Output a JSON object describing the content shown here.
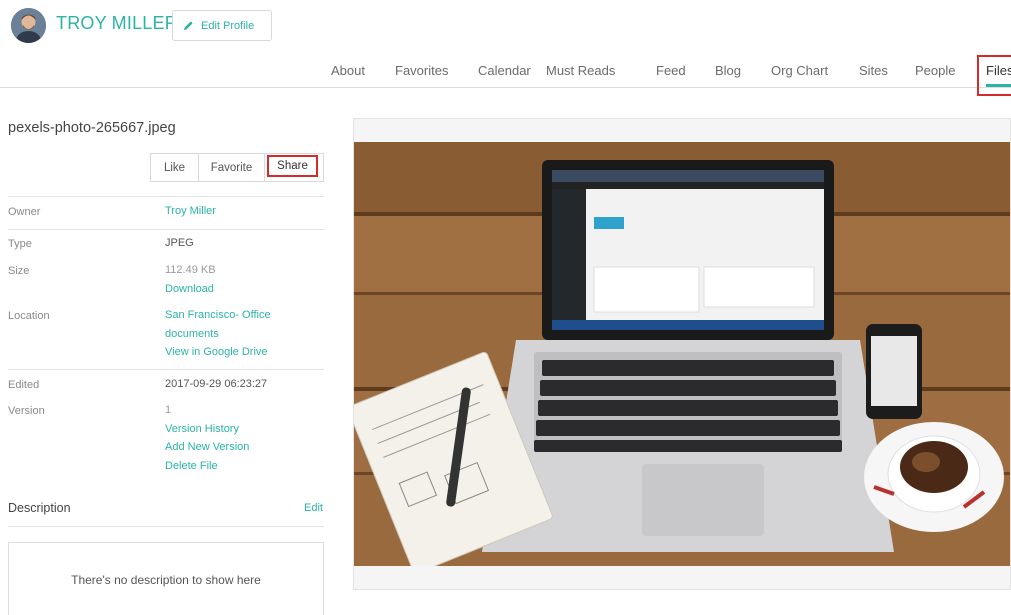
{
  "header": {
    "user_name": "TROY MILLER",
    "edit_profile_label": "Edit Profile"
  },
  "nav": {
    "items": [
      "About",
      "Favorites",
      "Calendar",
      "Must Reads",
      "Feed",
      "Blog",
      "Org Chart",
      "Sites",
      "People",
      "Files"
    ],
    "active": "Files"
  },
  "file": {
    "title": "pexels-photo-265667.jpeg",
    "actions": {
      "like": "Like",
      "favorite": "Favorite",
      "share": "Share"
    },
    "owner_label": "Owner",
    "owner_value": "Troy Miller",
    "type_label": "Type",
    "type_value": "JPEG",
    "size_label": "Size",
    "size_value": "112.49 KB",
    "download_link": "Download",
    "location_label": "Location",
    "location_line1": "San Francisco- Office",
    "location_line2": "documents",
    "location_drive": "View in Google Drive",
    "edited_label": "Edited",
    "edited_value": "2017-09-29 06:23:27",
    "version_label": "Version",
    "version_value": "1",
    "version_history": "Version History",
    "add_new_version": "Add New Version",
    "delete_file": "Delete File"
  },
  "description": {
    "title": "Description",
    "edit_label": "Edit",
    "empty_text": "There's no description to show here"
  },
  "colors": {
    "accent": "#2bb3a6",
    "highlight_red": "#d62b2b"
  }
}
